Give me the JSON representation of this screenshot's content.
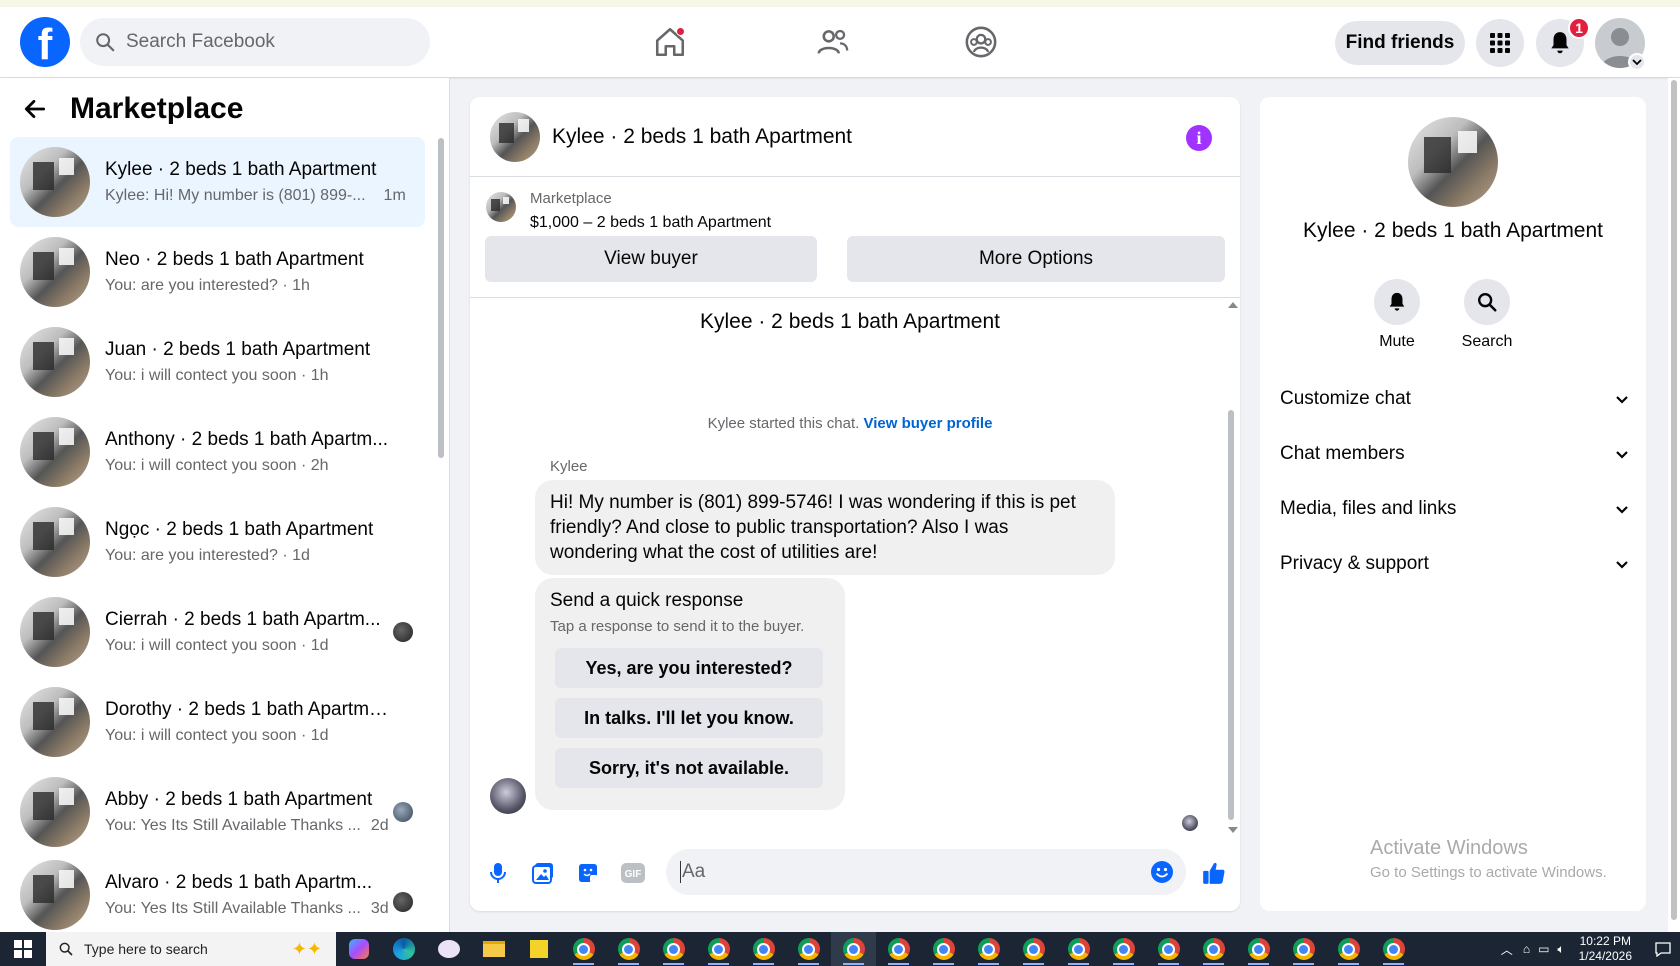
{
  "navbar": {
    "logo": "f",
    "search_placeholder": "Search Facebook",
    "find_friends": "Find friends",
    "notification_count": "1"
  },
  "left": {
    "title": "Marketplace",
    "conversations": [
      {
        "name": "Kylee · 2 beds 1 bath Apartment",
        "snippet": "Kylee: Hi! My number is (801) 899-...",
        "time": "1m",
        "active": true
      },
      {
        "name": "Neo · 2 beds 1 bath Apartment",
        "snippet": "You: are you interested? · 1h",
        "time": ""
      },
      {
        "name": "Juan · 2 beds 1 bath Apartment",
        "snippet": "You: i will contect you soon · 1h",
        "time": ""
      },
      {
        "name": "Anthony · 2 beds 1 bath Apartm...",
        "snippet": "You: i will contect you soon · 2h",
        "time": ""
      },
      {
        "name": "Ngọc · 2 beds 1 bath Apartment",
        "snippet": "You: are you interested? · 1d",
        "time": ""
      },
      {
        "name": "Cierrah · 2 beds 1 bath Apartm...",
        "snippet": "You: i will contect you soon · 1d",
        "time": ""
      },
      {
        "name": "Dorothy · 2 beds 1 bath Apartment",
        "snippet": "You: i will contect you soon · 1d",
        "time": ""
      },
      {
        "name": "Abby · 2 beds 1 bath Apartment",
        "snippet": "You: Yes Its Still Available Thanks ...",
        "time": "2d"
      },
      {
        "name": "Alvaro · 2 beds 1 bath Apartm...",
        "snippet": "You: Yes Its Still Available Thanks ...",
        "time": "3d"
      }
    ]
  },
  "chat": {
    "header_title": "Kylee · 2 beds 1 bath Apartment",
    "listing_source": "Marketplace",
    "listing_title": "$1,000 – 2 beds 1 bath Apartment",
    "view_buyer": "View buyer",
    "more_options": "More Options",
    "thread_title": "Kylee · 2 beds 1 bath Apartment",
    "started_text": "Kylee started this chat.",
    "view_buyer_profile": "View buyer profile",
    "sender": "Kylee",
    "message": "Hi! My number is (801) 899-5746! I was wondering if this is pet friendly? And close to public transportation? Also I was wondering what the cost of utilities are!",
    "quick_title": "Send a quick response",
    "quick_sub": "Tap a response to send it to the buyer.",
    "quick_responses": [
      "Yes, are you interested?",
      "In talks. I'll let you know.",
      "Sorry, it's not available."
    ],
    "input_placeholder": "Aa"
  },
  "right": {
    "name": "Kylee · 2 beds 1 bath Apartment",
    "mute": "Mute",
    "search": "Search",
    "sections": [
      "Customize chat",
      "Chat members",
      "Media, files and links",
      "Privacy & support"
    ],
    "activate_title": "Activate Windows",
    "activate_sub": "Go to Settings to activate Windows."
  },
  "taskbar": {
    "search_placeholder": "Type here to search",
    "time": "10:22 PM",
    "date": "1/24/2026"
  },
  "colors": {
    "brand": "#0866ff",
    "accent_purple": "#a033ff",
    "badge_red": "#e41e3f"
  }
}
